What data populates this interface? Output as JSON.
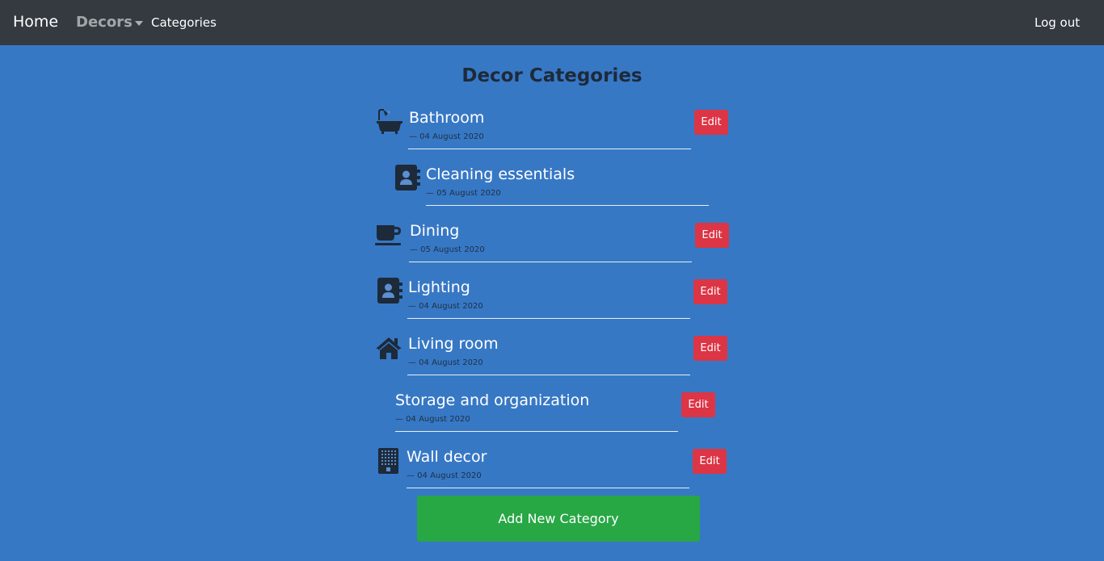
{
  "nav": {
    "home": "Home",
    "decors": "Decors",
    "categories": "Categories",
    "logout": "Log out"
  },
  "page_title": "Decor Categories",
  "categories": [
    {
      "name": "Bathroom",
      "date": "— 04 August 2020",
      "icon": "bathtub-icon",
      "edit_label": "Edit"
    },
    {
      "name": "Cleaning essentials",
      "date": "— 05 August 2020",
      "icon": "contact-book-icon"
    },
    {
      "name": "Dining",
      "date": "— 05 August 2020",
      "icon": "coffee-cup-icon",
      "edit_label": "Edit"
    },
    {
      "name": "Lighting",
      "date": "— 04 August 2020",
      "icon": "contact-book-icon",
      "edit_label": "Edit"
    },
    {
      "name": "Living room",
      "date": "— 04 August 2020",
      "icon": "home-icon",
      "edit_label": "Edit"
    },
    {
      "name": "Storage and organization",
      "date": "— 04 August 2020",
      "edit_label": "Edit"
    },
    {
      "name": "Wall decor",
      "date": "— 04 August 2020",
      "icon": "building-icon",
      "edit_label": "Edit"
    }
  ],
  "add_button": "Add New Category",
  "colors": {
    "background": "#3778c5",
    "navbar": "#343a40",
    "edit": "#dc3545",
    "add": "#28a745",
    "icon": "#1d2a3a"
  }
}
